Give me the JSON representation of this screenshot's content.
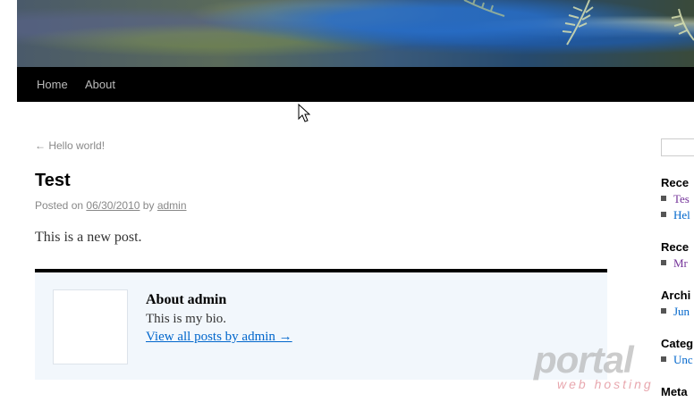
{
  "nav": {
    "items": [
      "Home",
      "About"
    ]
  },
  "post": {
    "prev_link": "← Hello world!",
    "title": "Test",
    "meta_prefix": "Posted on",
    "date": "06/30/2010",
    "meta_by": "by",
    "author": "admin",
    "body": "This is a new post."
  },
  "author_box": {
    "heading": "About admin",
    "bio": "This is my bio.",
    "link": "View all posts by admin →"
  },
  "sidebar": {
    "recent_posts_title": "Rece",
    "recent_posts": [
      "Tes",
      "Hel"
    ],
    "recent_comments_title": "Rece",
    "recent_comments": [
      "Mr"
    ],
    "archives_title": "Archi",
    "archives": [
      "Jun"
    ],
    "categories_title": "Categ",
    "categories": [
      "Unc"
    ],
    "meta_title": "Meta"
  },
  "watermark": {
    "brand": "portal",
    "tagline": "web hosting"
  },
  "colors": {
    "link": "#0066cc",
    "visited": "#743399",
    "author_box_bg": "#f2f7fc",
    "nav_bg": "#000000"
  }
}
